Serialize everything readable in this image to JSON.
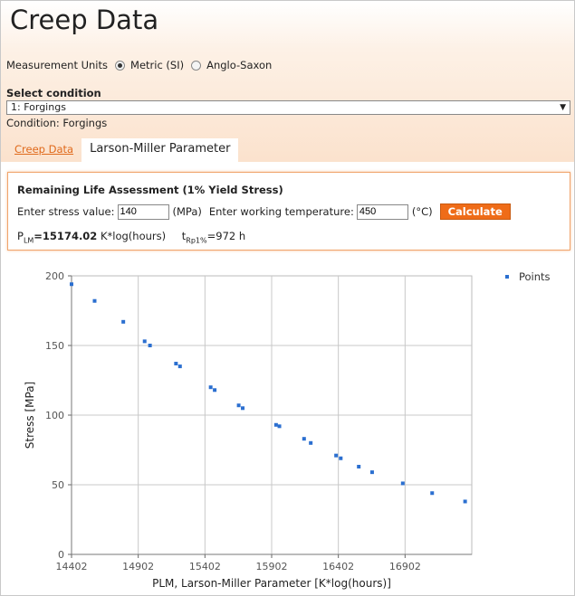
{
  "page": {
    "title": "Creep Data"
  },
  "units": {
    "label": "Measurement Units",
    "options": [
      "Metric (SI)",
      "Anglo-Saxon"
    ],
    "selected": "Metric (SI)"
  },
  "condition_select": {
    "label": "Select condition",
    "value": "1: Forgings",
    "condition_label": "Condition:",
    "condition_value": "Forgings"
  },
  "tabs": [
    {
      "label": "Creep Data",
      "active": false
    },
    {
      "label": "Larson-Miller Parameter",
      "active": true
    }
  ],
  "assessment": {
    "title": "Remaining Life Assessment (1% Yield Stress)",
    "stress_label": "Enter stress value:",
    "stress_value": "140",
    "stress_unit": "(MPa)",
    "temp_label": "Enter working temperature:",
    "temp_value": "450",
    "temp_unit": "(°C)",
    "calc_button": "Calculate",
    "plm_label": "P",
    "plm_sub": "LM",
    "plm_value": "=15174.02",
    "plm_unit": "K*log(hours)",
    "t_label": "t",
    "t_sub": "Rp1%",
    "t_value": "=972 h"
  },
  "colors": {
    "accent": "#ef6c18",
    "link": "#e06a1c",
    "point": "#2b6fd0"
  },
  "chart_data": {
    "type": "scatter",
    "title": "",
    "xlabel": "PLM, Larson-Miller Parameter [K*log(hours)]",
    "ylabel": "Stress [MPa]",
    "xlim": [
      14402,
      17402
    ],
    "ylim": [
      0,
      200
    ],
    "x_ticks": [
      14402,
      14902,
      15402,
      15902,
      16402,
      16902
    ],
    "y_ticks": [
      0,
      50,
      100,
      150,
      200
    ],
    "grid": true,
    "legend_position": "top-right",
    "series": [
      {
        "name": "Points",
        "x": [
          14402,
          14575,
          14790,
          14950,
          14990,
          15185,
          15215,
          15445,
          15475,
          15655,
          15685,
          15935,
          15960,
          16145,
          16195,
          16385,
          16420,
          16555,
          16655,
          16885,
          17105,
          17352
        ],
        "y": [
          194,
          182,
          167,
          153,
          150,
          137,
          135,
          120,
          118,
          107,
          105,
          93,
          92,
          83,
          80,
          71,
          69,
          63,
          59,
          51,
          44,
          38
        ]
      }
    ]
  }
}
